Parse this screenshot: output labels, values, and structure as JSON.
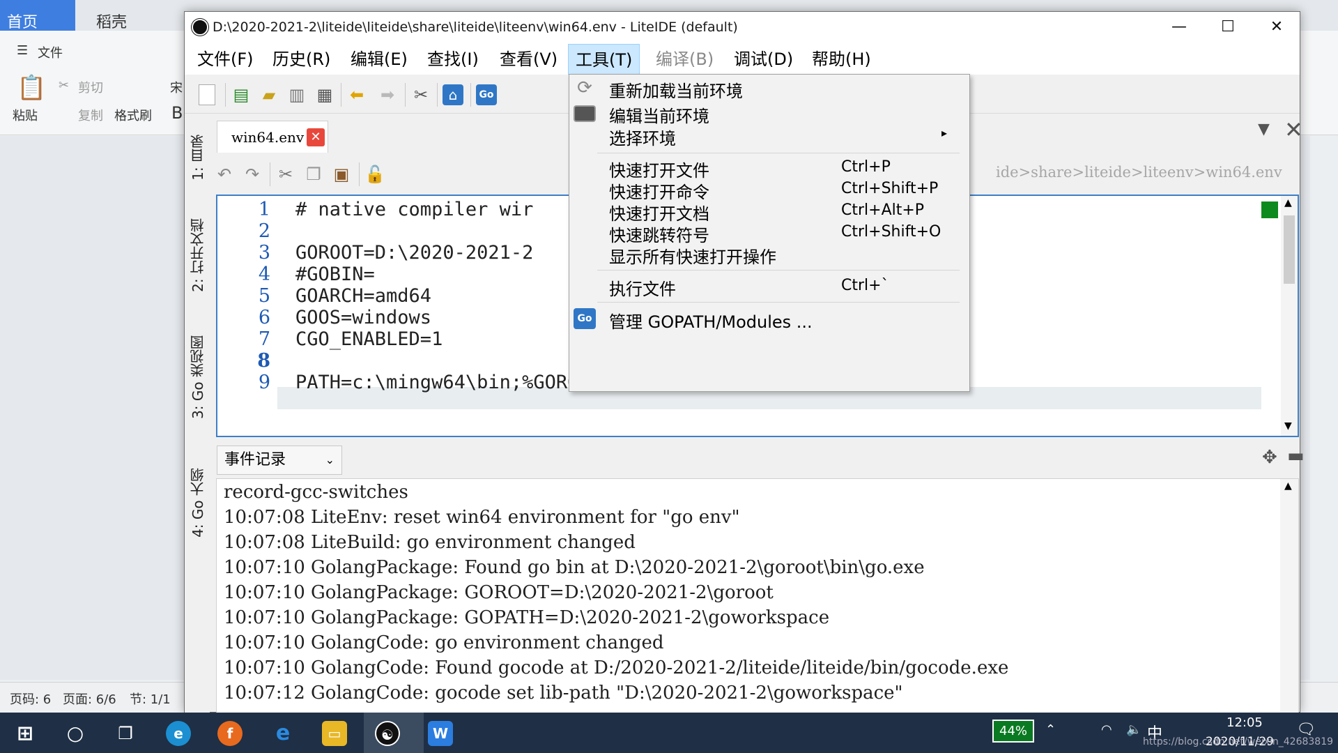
{
  "wps": {
    "tab1": "首页",
    "tab2": "稻壳",
    "file_menu": "文件",
    "paste": "粘贴",
    "cut": "剪切",
    "copy": "复制",
    "format_painter": "格式刷",
    "font_partial": "宋",
    "bold_partial": "B",
    "status_page_code": "页码: 6",
    "status_page": "页面: 6/6",
    "status_section": "节: 1/1"
  },
  "ide": {
    "window_title": "D:\\2020-2021-2\\liteide\\liteide\\share\\liteide\\liteenv\\win64.env - LiteIDE (default)",
    "menus": [
      {
        "label": "文件(F)",
        "state": "normal"
      },
      {
        "label": "历史(R)",
        "state": "normal"
      },
      {
        "label": "编辑(E)",
        "state": "normal"
      },
      {
        "label": "查找(I)",
        "state": "normal"
      },
      {
        "label": "查看(V)",
        "state": "normal"
      },
      {
        "label": "工具(T)",
        "state": "active"
      },
      {
        "label": "编译(B)",
        "state": "disabled"
      },
      {
        "label": "调试(D)",
        "state": "normal"
      },
      {
        "label": "帮助(H)",
        "state": "normal"
      }
    ],
    "left_dock_tabs": [
      "1: 目录",
      "2: 打开文档",
      "3: Go 类视图",
      "4: Go 大纲"
    ],
    "editor_tab": "win64.env",
    "breadcrumb": "ide>share>liteide>liteenv>win64.env",
    "line_numbers": [
      "1",
      "2",
      "3",
      "4",
      "5",
      "6",
      "7",
      "8",
      "9"
    ],
    "code_lines": [
      "# native compiler wir",
      "",
      "GOROOT=D:\\2020-2021-2",
      "#GOBIN=",
      "GOARCH=amd64",
      "GOOS=windows",
      "CGO_ENABLED=1",
      "",
      "PATH=c:\\mingw64\\bin;%GOROOT%\\bin;%PATH%"
    ],
    "current_line": 8,
    "output_selector": "事件记录",
    "output_lines": [
      "record-gcc-switches",
      "10:07:08 LiteEnv: reset win64 environment for \"go env\"",
      "10:07:08 LiteBuild: go environment changed",
      "10:07:10 GolangPackage: Found go bin at D:\\2020-2021-2\\goroot\\bin\\go.exe",
      "10:07:10 GolangPackage: GOROOT=D:\\2020-2021-2\\goroot",
      "10:07:10 GolangPackage: GOPATH=D:\\2020-2021-2\\goworkspace",
      "10:07:10 GolangCode: go environment changed",
      "10:07:10 GolangCode: Found gocode at D:/2020-2021-2/liteide/liteide/bin/gocode.exe",
      "10:07:12 GolangCode: gocode set lib-path \"D:\\2020-2021-2\\goworkspace\""
    ]
  },
  "tools_menu": {
    "items": [
      {
        "label": "重新加载当前环境",
        "shortcut": "",
        "icon": "reload-icon"
      },
      {
        "label": "编辑当前环境",
        "shortcut": "",
        "icon": "edit-env-icon"
      },
      {
        "label": "选择环境",
        "shortcut": "",
        "icon": "",
        "submenu": true
      },
      {
        "label": "快速打开文件",
        "shortcut": "Ctrl+P"
      },
      {
        "label": "快速打开命令",
        "shortcut": "Ctrl+Shift+P"
      },
      {
        "label": "快速打开文档",
        "shortcut": "Ctrl+Alt+P"
      },
      {
        "label": "快速跳转符号",
        "shortcut": "Ctrl+Shift+O"
      },
      {
        "label": "显示所有快速打开操作",
        "shortcut": ""
      },
      {
        "label": "执行文件",
        "shortcut": "Ctrl+`"
      },
      {
        "label": "管理 GOPATH/Modules ...",
        "shortcut": "",
        "icon": "go-icon"
      }
    ]
  },
  "taskbar": {
    "battery": "44%",
    "ime": "中",
    "time": "12:05",
    "date": "2020/11/29",
    "watermark": "https://blog.csdn.net/weixin_42683819"
  },
  "colors": {
    "menu_active_bg": "#cce8ff",
    "editor_border": "#3c7fc9",
    "line_number": "#1e5ab4",
    "taskbar": "#1f2f45",
    "wps_tab_active": "#3e7ee0"
  }
}
